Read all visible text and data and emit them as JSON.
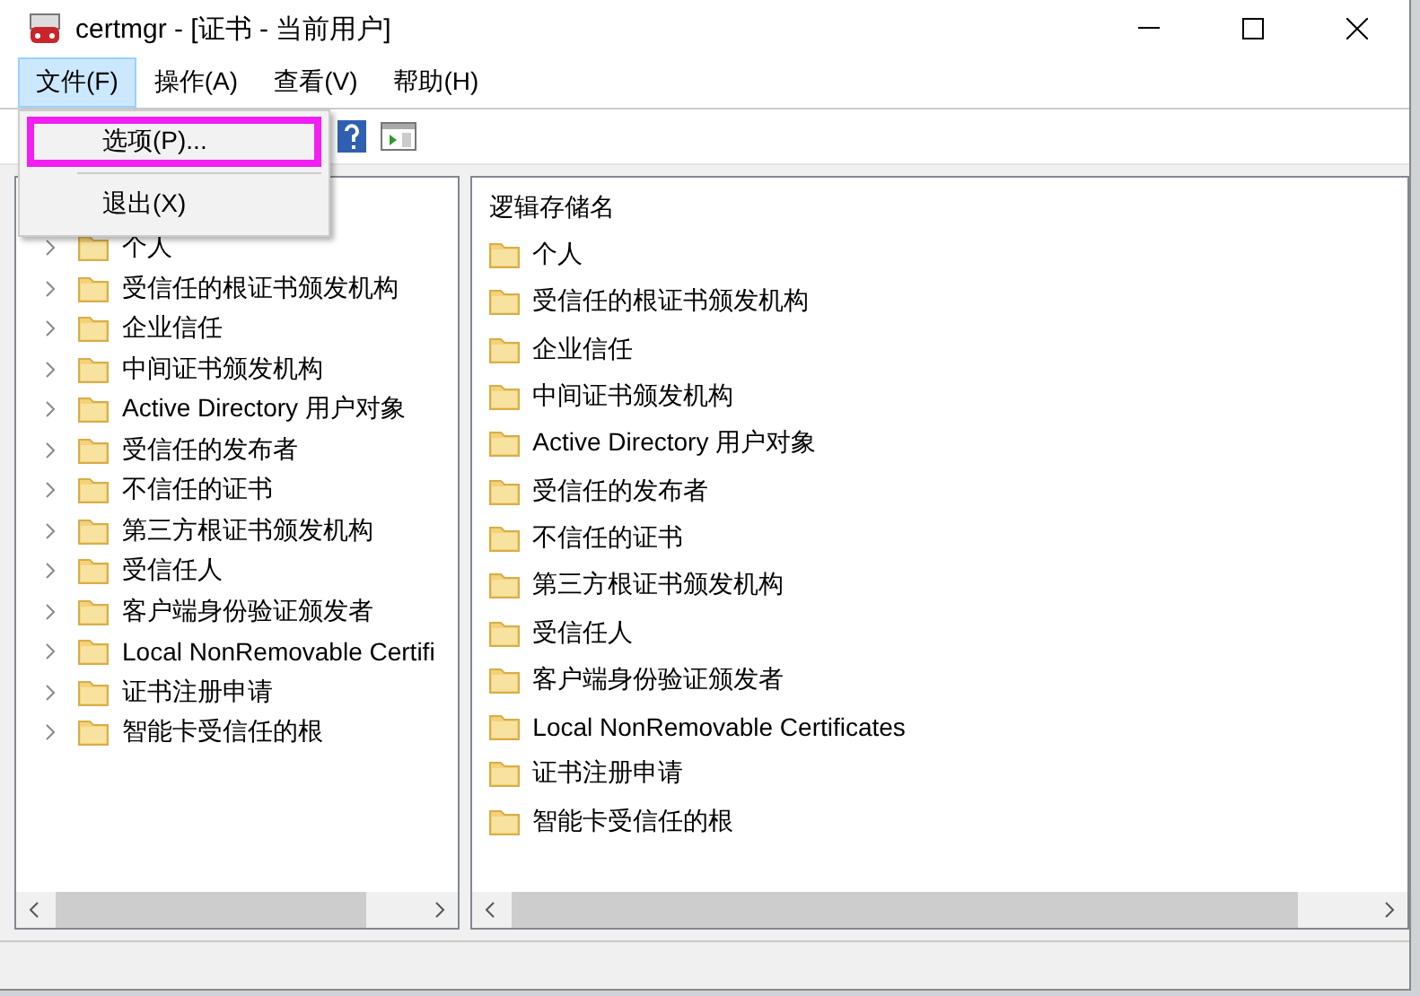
{
  "window": {
    "title": "certmgr - [证书 - 当前用户]"
  },
  "menu_bar": [
    {
      "label": "文件(F)",
      "selected": true
    },
    {
      "label": "操作(A)",
      "selected": false
    },
    {
      "label": "查看(V)",
      "selected": false
    },
    {
      "label": "帮助(H)",
      "selected": false
    }
  ],
  "file_menu": [
    {
      "label": "选项(P)...",
      "highlighted": true
    },
    {
      "label": "退出(X)",
      "highlighted": false
    }
  ],
  "tree": {
    "items": [
      {
        "label": "个人"
      },
      {
        "label": "受信任的根证书颁发机构"
      },
      {
        "label": "企业信任"
      },
      {
        "label": "中间证书颁发机构"
      },
      {
        "label": "Active Directory 用户对象"
      },
      {
        "label": "受信任的发布者"
      },
      {
        "label": "不信任的证书"
      },
      {
        "label": "第三方根证书颁发机构"
      },
      {
        "label": "受信任人"
      },
      {
        "label": "客户端身份验证颁发者"
      },
      {
        "label": "Local NonRemovable Certifi"
      },
      {
        "label": "证书注册申请"
      },
      {
        "label": "智能卡受信任的根"
      }
    ]
  },
  "list": {
    "column": "逻辑存储名",
    "rows": [
      "个人",
      "受信任的根证书颁发机构",
      "企业信任",
      "中间证书颁发机构",
      "Active Directory 用户对象",
      "受信任的发布者",
      "不信任的证书",
      "第三方根证书颁发机构",
      "受信任人",
      "客户端身份验证颁发者",
      "Local NonRemovable Certificates",
      "证书注册申请",
      "智能卡受信任的根"
    ]
  }
}
